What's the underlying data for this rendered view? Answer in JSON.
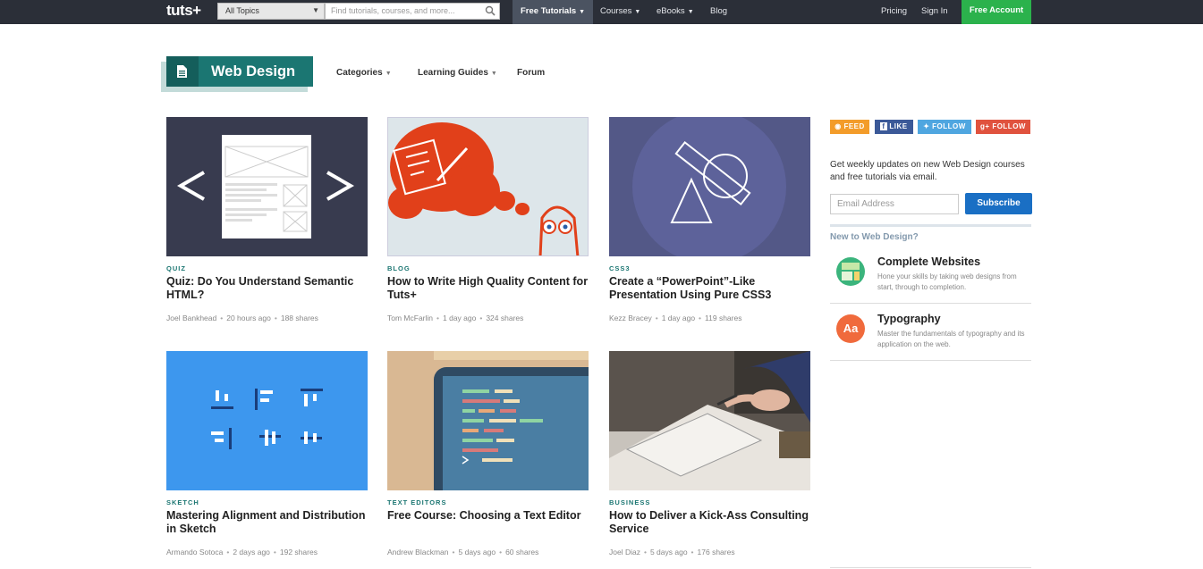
{
  "topbar": {
    "logo": "tuts+",
    "topic_select": "All Topics",
    "search_placeholder": "Find tutorials, courses, and more...",
    "nav": [
      {
        "label": "Free Tutorials"
      },
      {
        "label": "Courses"
      },
      {
        "label": "eBooks"
      },
      {
        "label": "Blog"
      }
    ],
    "pricing": "Pricing",
    "sign_in": "Sign In",
    "free_account": "Free Account"
  },
  "brand": {
    "title": "Web Design",
    "subnav": [
      "Categories",
      "Learning Guides",
      "Forum"
    ]
  },
  "cards": [
    {
      "category": "Quiz",
      "title": "Quiz: Do You Understand Semantic HTML?",
      "author": "Joel Bankhead",
      "time": "20 hours ago",
      "shares": "188 shares"
    },
    {
      "category": "Blog",
      "title": "How to Write High Quality Content for Tuts+",
      "author": "Tom McFarlin",
      "time": "1 day ago",
      "shares": "324 shares"
    },
    {
      "category": "CSS3",
      "title": "Create a “PowerPoint”-Like Presentation Using Pure CSS3",
      "author": "Kezz Bracey",
      "time": "1 day ago",
      "shares": "119 shares"
    },
    {
      "category": "Sketch",
      "title": "Mastering Alignment and Distribution in Sketch",
      "author": "Armando Sotoca",
      "time": "2 days ago",
      "shares": "192 shares"
    },
    {
      "category": "Text Editors",
      "title": "Free Course: Choosing a Text Editor",
      "author": "Andrew Blackman",
      "time": "5 days ago",
      "shares": "60 shares"
    },
    {
      "category": "Business",
      "title": "How to Deliver a Kick-Ass Consulting Service",
      "author": "Joel Diaz",
      "time": "5 days ago",
      "shares": "176 shares"
    }
  ],
  "sidebar": {
    "social": [
      "FEED",
      "LIKE",
      "FOLLOW",
      "FOLLOW"
    ],
    "newsletter_text": "Get weekly updates on new Web Design courses and free tutorials via email.",
    "email_placeholder": "Email Address",
    "subscribe": "Subscribe",
    "new_to": "New to Web Design?",
    "guides": [
      {
        "title": "Complete Websites",
        "desc": "Hone your skills by taking web designs from start, through to completion."
      },
      {
        "title": "Typography",
        "icon_text": "Aa",
        "desc": "Master the fundamentals of typography and its application on the web."
      }
    ]
  },
  "colors": {
    "topbar": "#2b2f38",
    "brand": "#1b7672",
    "free_account": "#2bb24c",
    "subscribe": "#1a6fc4",
    "feed": "#f39c2a",
    "facebook": "#3b5998",
    "twitter": "#4fa6e0",
    "google": "#e0523e"
  }
}
